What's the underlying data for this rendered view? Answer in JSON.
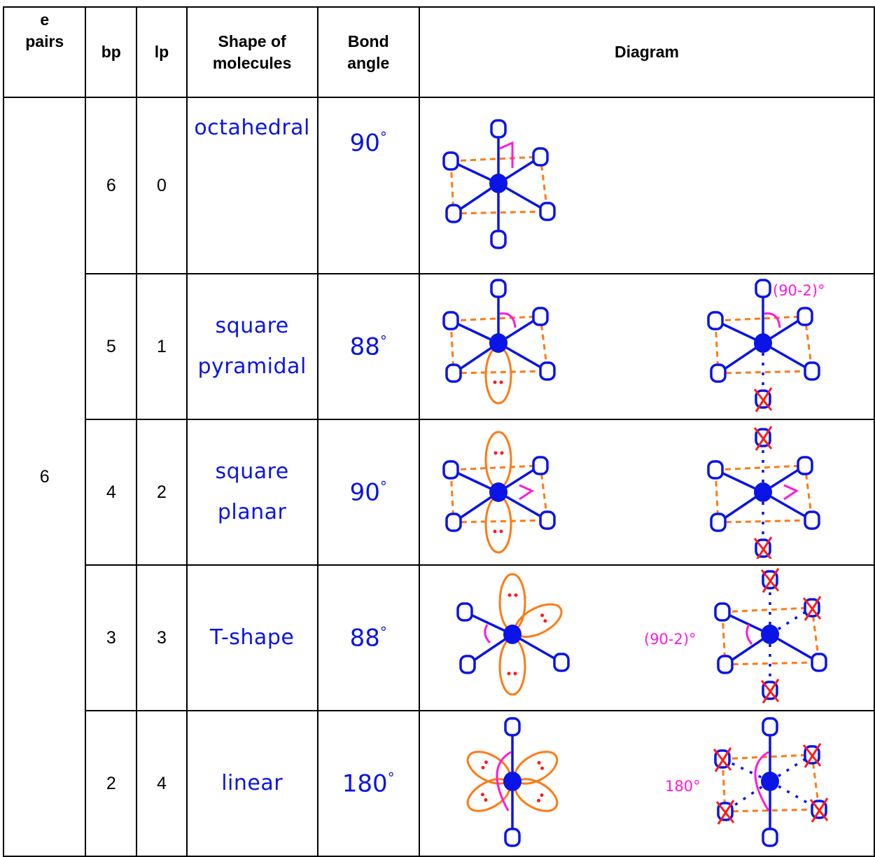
{
  "header": {
    "e_pairs": [
      "e",
      "pairs"
    ],
    "bp": "bp",
    "lp": "lp",
    "shape": [
      "Shape of",
      "molecules"
    ],
    "bond_angle": [
      "Bond",
      "angle"
    ],
    "diagram": "Diagram"
  },
  "e_pairs_value": "6",
  "rows": [
    {
      "bp": "6",
      "lp": "0",
      "shape": [
        "octahedral"
      ],
      "angle": "90",
      "deg": "°",
      "note": ""
    },
    {
      "bp": "5",
      "lp": "1",
      "shape": [
        "square",
        "pyramidal"
      ],
      "angle": "88",
      "deg": "°",
      "note": "(90-2)°"
    },
    {
      "bp": "4",
      "lp": "2",
      "shape": [
        "square",
        "planar"
      ],
      "angle": "90",
      "deg": "°",
      "note": ""
    },
    {
      "bp": "3",
      "lp": "3",
      "shape": [
        "T-shape"
      ],
      "angle": "88",
      "deg": "°",
      "note": "(90-2)°"
    },
    {
      "bp": "2",
      "lp": "4",
      "shape": [
        "linear"
      ],
      "angle": "180",
      "deg": "°",
      "note": "180°"
    }
  ],
  "colors": {
    "bond": "#0a14e6",
    "lone_pair": "#ff7a14",
    "electrons": "#ff1a1a",
    "angle_mark": "#ff1ad9",
    "cross": "#ff1a1a"
  }
}
